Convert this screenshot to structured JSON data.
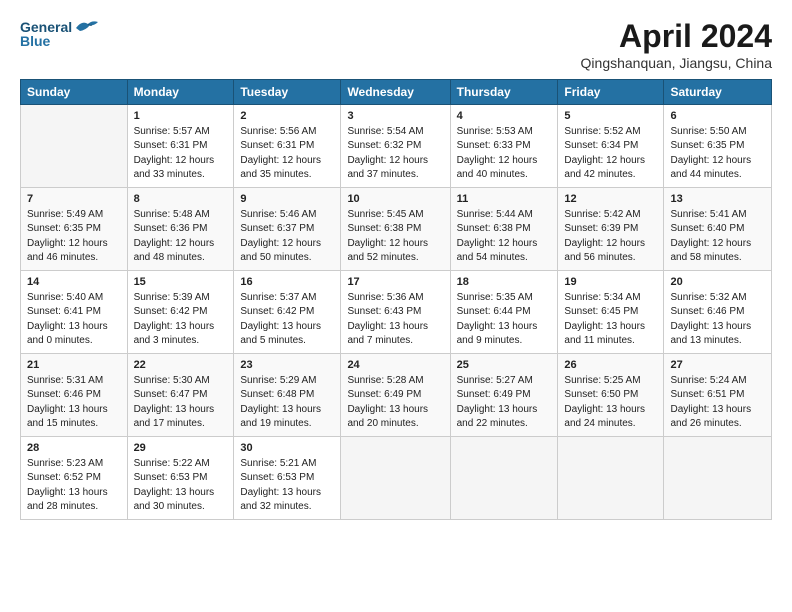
{
  "header": {
    "logo_line1": "General",
    "logo_line2": "Blue",
    "title": "April 2024",
    "subtitle": "Qingshanquan, Jiangsu, China"
  },
  "columns": [
    "Sunday",
    "Monday",
    "Tuesday",
    "Wednesday",
    "Thursday",
    "Friday",
    "Saturday"
  ],
  "weeks": [
    [
      {
        "day": "",
        "sunrise": "",
        "sunset": "",
        "daylight": ""
      },
      {
        "day": "1",
        "sunrise": "Sunrise: 5:57 AM",
        "sunset": "Sunset: 6:31 PM",
        "daylight": "Daylight: 12 hours and 33 minutes."
      },
      {
        "day": "2",
        "sunrise": "Sunrise: 5:56 AM",
        "sunset": "Sunset: 6:31 PM",
        "daylight": "Daylight: 12 hours and 35 minutes."
      },
      {
        "day": "3",
        "sunrise": "Sunrise: 5:54 AM",
        "sunset": "Sunset: 6:32 PM",
        "daylight": "Daylight: 12 hours and 37 minutes."
      },
      {
        "day": "4",
        "sunrise": "Sunrise: 5:53 AM",
        "sunset": "Sunset: 6:33 PM",
        "daylight": "Daylight: 12 hours and 40 minutes."
      },
      {
        "day": "5",
        "sunrise": "Sunrise: 5:52 AM",
        "sunset": "Sunset: 6:34 PM",
        "daylight": "Daylight: 12 hours and 42 minutes."
      },
      {
        "day": "6",
        "sunrise": "Sunrise: 5:50 AM",
        "sunset": "Sunset: 6:35 PM",
        "daylight": "Daylight: 12 hours and 44 minutes."
      }
    ],
    [
      {
        "day": "7",
        "sunrise": "Sunrise: 5:49 AM",
        "sunset": "Sunset: 6:35 PM",
        "daylight": "Daylight: 12 hours and 46 minutes."
      },
      {
        "day": "8",
        "sunrise": "Sunrise: 5:48 AM",
        "sunset": "Sunset: 6:36 PM",
        "daylight": "Daylight: 12 hours and 48 minutes."
      },
      {
        "day": "9",
        "sunrise": "Sunrise: 5:46 AM",
        "sunset": "Sunset: 6:37 PM",
        "daylight": "Daylight: 12 hours and 50 minutes."
      },
      {
        "day": "10",
        "sunrise": "Sunrise: 5:45 AM",
        "sunset": "Sunset: 6:38 PM",
        "daylight": "Daylight: 12 hours and 52 minutes."
      },
      {
        "day": "11",
        "sunrise": "Sunrise: 5:44 AM",
        "sunset": "Sunset: 6:38 PM",
        "daylight": "Daylight: 12 hours and 54 minutes."
      },
      {
        "day": "12",
        "sunrise": "Sunrise: 5:42 AM",
        "sunset": "Sunset: 6:39 PM",
        "daylight": "Daylight: 12 hours and 56 minutes."
      },
      {
        "day": "13",
        "sunrise": "Sunrise: 5:41 AM",
        "sunset": "Sunset: 6:40 PM",
        "daylight": "Daylight: 12 hours and 58 minutes."
      }
    ],
    [
      {
        "day": "14",
        "sunrise": "Sunrise: 5:40 AM",
        "sunset": "Sunset: 6:41 PM",
        "daylight": "Daylight: 13 hours and 0 minutes."
      },
      {
        "day": "15",
        "sunrise": "Sunrise: 5:39 AM",
        "sunset": "Sunset: 6:42 PM",
        "daylight": "Daylight: 13 hours and 3 minutes."
      },
      {
        "day": "16",
        "sunrise": "Sunrise: 5:37 AM",
        "sunset": "Sunset: 6:42 PM",
        "daylight": "Daylight: 13 hours and 5 minutes."
      },
      {
        "day": "17",
        "sunrise": "Sunrise: 5:36 AM",
        "sunset": "Sunset: 6:43 PM",
        "daylight": "Daylight: 13 hours and 7 minutes."
      },
      {
        "day": "18",
        "sunrise": "Sunrise: 5:35 AM",
        "sunset": "Sunset: 6:44 PM",
        "daylight": "Daylight: 13 hours and 9 minutes."
      },
      {
        "day": "19",
        "sunrise": "Sunrise: 5:34 AM",
        "sunset": "Sunset: 6:45 PM",
        "daylight": "Daylight: 13 hours and 11 minutes."
      },
      {
        "day": "20",
        "sunrise": "Sunrise: 5:32 AM",
        "sunset": "Sunset: 6:46 PM",
        "daylight": "Daylight: 13 hours and 13 minutes."
      }
    ],
    [
      {
        "day": "21",
        "sunrise": "Sunrise: 5:31 AM",
        "sunset": "Sunset: 6:46 PM",
        "daylight": "Daylight: 13 hours and 15 minutes."
      },
      {
        "day": "22",
        "sunrise": "Sunrise: 5:30 AM",
        "sunset": "Sunset: 6:47 PM",
        "daylight": "Daylight: 13 hours and 17 minutes."
      },
      {
        "day": "23",
        "sunrise": "Sunrise: 5:29 AM",
        "sunset": "Sunset: 6:48 PM",
        "daylight": "Daylight: 13 hours and 19 minutes."
      },
      {
        "day": "24",
        "sunrise": "Sunrise: 5:28 AM",
        "sunset": "Sunset: 6:49 PM",
        "daylight": "Daylight: 13 hours and 20 minutes."
      },
      {
        "day": "25",
        "sunrise": "Sunrise: 5:27 AM",
        "sunset": "Sunset: 6:49 PM",
        "daylight": "Daylight: 13 hours and 22 minutes."
      },
      {
        "day": "26",
        "sunrise": "Sunrise: 5:25 AM",
        "sunset": "Sunset: 6:50 PM",
        "daylight": "Daylight: 13 hours and 24 minutes."
      },
      {
        "day": "27",
        "sunrise": "Sunrise: 5:24 AM",
        "sunset": "Sunset: 6:51 PM",
        "daylight": "Daylight: 13 hours and 26 minutes."
      }
    ],
    [
      {
        "day": "28",
        "sunrise": "Sunrise: 5:23 AM",
        "sunset": "Sunset: 6:52 PM",
        "daylight": "Daylight: 13 hours and 28 minutes."
      },
      {
        "day": "29",
        "sunrise": "Sunrise: 5:22 AM",
        "sunset": "Sunset: 6:53 PM",
        "daylight": "Daylight: 13 hours and 30 minutes."
      },
      {
        "day": "30",
        "sunrise": "Sunrise: 5:21 AM",
        "sunset": "Sunset: 6:53 PM",
        "daylight": "Daylight: 13 hours and 32 minutes."
      },
      {
        "day": "",
        "sunrise": "",
        "sunset": "",
        "daylight": ""
      },
      {
        "day": "",
        "sunrise": "",
        "sunset": "",
        "daylight": ""
      },
      {
        "day": "",
        "sunrise": "",
        "sunset": "",
        "daylight": ""
      },
      {
        "day": "",
        "sunrise": "",
        "sunset": "",
        "daylight": ""
      }
    ]
  ]
}
